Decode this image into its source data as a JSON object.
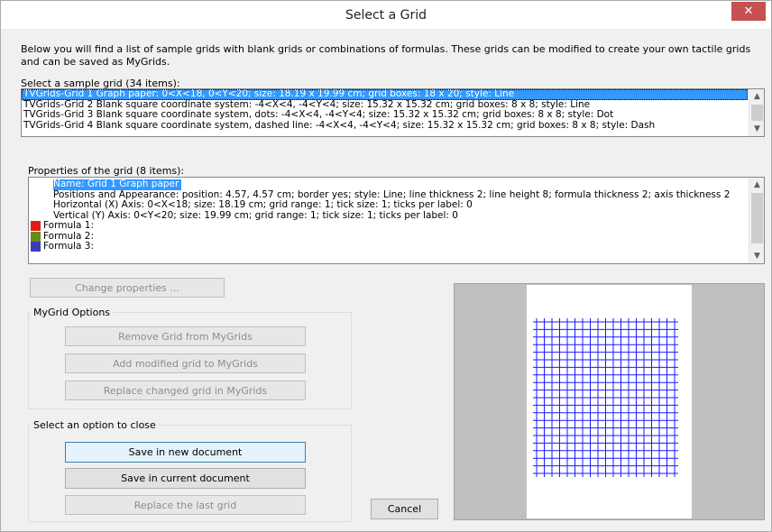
{
  "window": {
    "title": "Select a Grid",
    "close_glyph": "✕"
  },
  "intro": "Below you will find a list of sample grids with blank grids or combinations of formulas. These grids can be modified to create your own tactile grids and can be saved as MyGrids.",
  "sample_list": {
    "label": "Select a sample grid (34 items):",
    "items": [
      "TVGrids-Grid 1 Graph paper: 0<X<18, 0<Y<20; size: 18.19 x 19.99 cm; grid boxes: 18 x 20; style: Line",
      "TVGrids-Grid 2 Blank square coordinate system: -4<X<4, -4<Y<4; size: 15.32 x 15.32 cm; grid boxes: 8 x 8; style: Line",
      "TVGrids-Grid 3 Blank square coordinate system, dots: -4<X<4, -4<Y<4; size: 15.32 x 15.32 cm; grid boxes: 8 x 8; style: Dot",
      "TVGrids-Grid 4 Blank square coordinate system, dashed line: -4<X<4, -4<Y<4; size: 15.32 x 15.32 cm; grid boxes: 8 x 8; style: Dash"
    ],
    "selected_index": 0
  },
  "properties_list": {
    "label": "Properties of the grid (8 items):",
    "items": [
      {
        "text": "Name: Grid 1 Graph paper",
        "color": ""
      },
      {
        "text": "Positions and Appearance: position: 4.57, 4.57 cm; border yes; style: Line; line thickness 2; line height 8; formula thickness 2; axis thickness 2",
        "color": ""
      },
      {
        "text": "Horizontal (X) Axis: 0<X<18; size: 18.19 cm; grid range: 1; tick size: 1; ticks per label: 0",
        "color": ""
      },
      {
        "text": "Vertical (Y) Axis: 0<Y<20; size: 19.99 cm; grid range: 1; tick size: 1; ticks per label: 0",
        "color": ""
      },
      {
        "text": "Formula 1:",
        "color": "#e31b1b"
      },
      {
        "text": "Formula 2:",
        "color": "#6a8a1a"
      },
      {
        "text": "Formula 3:",
        "color": "#3b3bb5"
      }
    ]
  },
  "buttons": {
    "change_properties": "Change properties ...",
    "remove_grid": "Remove Grid from MyGrids",
    "add_modified": "Add modified grid to MyGrids",
    "replace_changed": "Replace changed grid in MyGrids",
    "save_new": "Save in new document",
    "save_current": "Save in current document",
    "replace_last": "Replace the last grid",
    "cancel": "Cancel"
  },
  "groups": {
    "mygrid_options": "MyGrid Options",
    "close_options": "Select an option to close"
  },
  "preview": {
    "grid_color": "#1a1aff",
    "cols": 18,
    "rows": 20
  }
}
